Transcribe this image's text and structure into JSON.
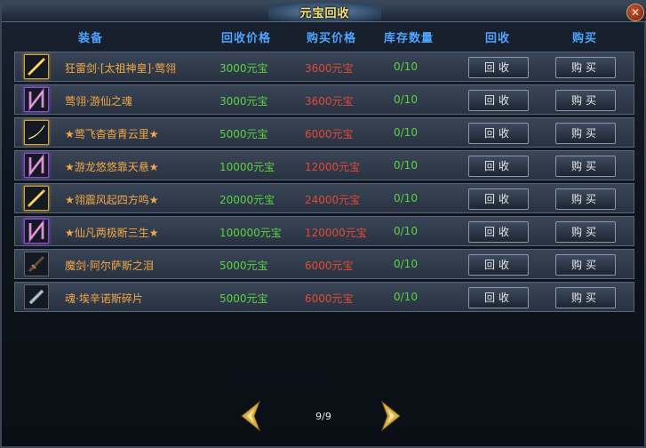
{
  "window": {
    "title": "元宝回收",
    "close_label": "✕"
  },
  "headers": {
    "equipment": "装备",
    "recycle_price": "回收价格",
    "buy_price": "购买价格",
    "stock": "库存数量",
    "recycle": "回收",
    "buy": "购买"
  },
  "rows": [
    {
      "name": "狂雷剑·[太祖神皇]·莺翎",
      "recycle_price": "3000元宝",
      "buy_price": "3600元宝",
      "stock": "0/10",
      "icon": "gold-sword-icon"
    },
    {
      "name": "莺翎·游仙之魂",
      "recycle_price": "3000元宝",
      "buy_price": "3600元宝",
      "stock": "0/10",
      "icon": "purple-bow-icon"
    },
    {
      "name": "★莺飞杳杳青云里★",
      "recycle_price": "5000元宝",
      "buy_price": "6000元宝",
      "stock": "0/10",
      "icon": "gold-blade-icon"
    },
    {
      "name": "★游龙悠悠靠天悬★",
      "recycle_price": "10000元宝",
      "buy_price": "12000元宝",
      "stock": "0/10",
      "icon": "purple-bow-icon"
    },
    {
      "name": "★翎震风起四方鸣★",
      "recycle_price": "20000元宝",
      "buy_price": "24000元宝",
      "stock": "0/10",
      "icon": "gold-sword-icon"
    },
    {
      "name": "★仙凡两极断三生★",
      "recycle_price": "100000元宝",
      "buy_price": "120000元宝",
      "stock": "0/10",
      "icon": "purple-bow-icon"
    },
    {
      "name": "魔剑·阿尔萨斯之泪",
      "recycle_price": "5000元宝",
      "buy_price": "6000元宝",
      "stock": "0/10",
      "icon": "dark-sword-icon"
    },
    {
      "name": "魂·埃辛诺斯碎片",
      "recycle_price": "5000元宝",
      "buy_price": "6000元宝",
      "stock": "0/10",
      "icon": "shard-icon"
    }
  ],
  "buttons": {
    "recycle": "回收",
    "buy": "购买"
  },
  "pager": {
    "page": "9/9"
  },
  "colors": {
    "header": "#4fa4ff",
    "name": "#f3a845",
    "recycle_price": "#5cd243",
    "buy_price": "#e24a33",
    "stock": "#5cd243",
    "title": "#f6e27a"
  }
}
